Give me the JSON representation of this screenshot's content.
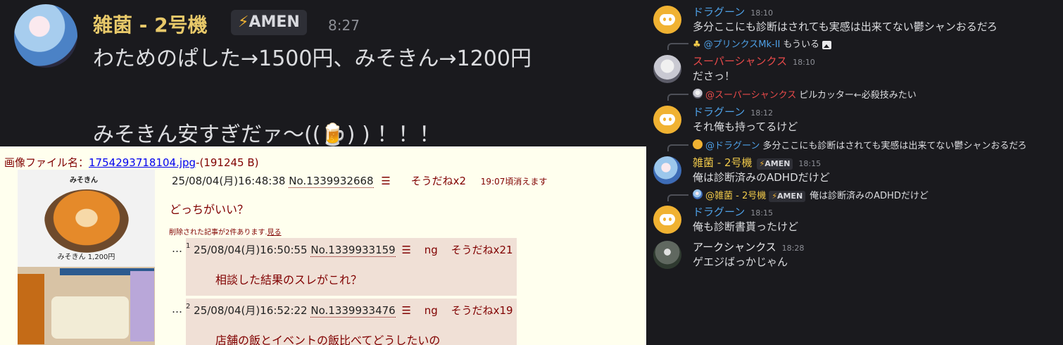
{
  "zoom": {
    "name": "雑菌 - 2号機",
    "tag_bolt": "⚡",
    "tag_text": "AMEN",
    "time": "8:27",
    "line1": "わためのぱした→1500円、みそきん→1200円",
    "line2": "みそきん安すぎだァ〜((🍺) ) ！！！"
  },
  "futaba": {
    "file_label": "画像ファイル名：",
    "file_link": "1754293718104.jpg",
    "file_size": "-(191245 B)",
    "thumb_shop": "みそきん",
    "thumb_price": "みそきん 1,200円",
    "op_date": "25/08/04(月)16:48:38",
    "op_no": "No.1339932668",
    "op_menu": "☰",
    "op_soudane": "そうだねx2",
    "op_expire": "19:07頃消えます",
    "op_body": "どっちがいい？",
    "deleted": "削除された記事が2件あります.",
    "deleted_link": "見る",
    "replies": [
      {
        "ell": "…",
        "num": "1",
        "date": "25/08/04(月)16:50:55",
        "no": "No.1339933159",
        "menu": "☰",
        "ng": "ng",
        "soudane": "そうだねx21",
        "body": "相談した結果のスレがこれ？"
      },
      {
        "ell": "…",
        "num": "2",
        "date": "25/08/04(月)16:52:22",
        "no": "No.1339933476",
        "menu": "☰",
        "ng": "ng",
        "soudane": "そうだねx19",
        "body": "店舗の飯とイベントの飯比べてどうしたいの"
      }
    ]
  },
  "discord": {
    "m1": {
      "name": "ドラグーン",
      "time": "18:10",
      "text": "多分ここにも診断はされても実感は出来てない鬱シャンおるだろ"
    },
    "r1": {
      "icon": "♣",
      "mention": "@プリンクスMk-II",
      "text": "もういる"
    },
    "m2": {
      "name": "スーパーシャンクス",
      "time": "18:10",
      "text": "ださっ！"
    },
    "r2": {
      "mention": "@スーパーシャンクス",
      "text": "ピルカッター←必殺技みたい"
    },
    "m3": {
      "name": "ドラグーン",
      "time": "18:12",
      "text": "それ俺も持ってるけど"
    },
    "r3": {
      "mention": "@ドラグーン",
      "text": "多分ここにも診断はされても実感は出来てない鬱シャンおるだろ"
    },
    "m4": {
      "name": "雑菌 - 2号機",
      "tag_bolt": "⚡",
      "tag_text": "AMEN",
      "time": "18:15",
      "text": "俺は診断済みのADHDだけど"
    },
    "r4": {
      "mention": "@雑菌 - 2号機",
      "tag_bolt": "⚡",
      "tag_text": "AMEN",
      "text": "俺は診断済みのADHDだけど"
    },
    "m5": {
      "name": "ドラグーン",
      "time": "18:15",
      "text": "俺も診断書貰ったけど"
    },
    "m6": {
      "name": "アークシャンクス",
      "time": "18:28",
      "text": "ゲエジばっかじゃん"
    }
  }
}
